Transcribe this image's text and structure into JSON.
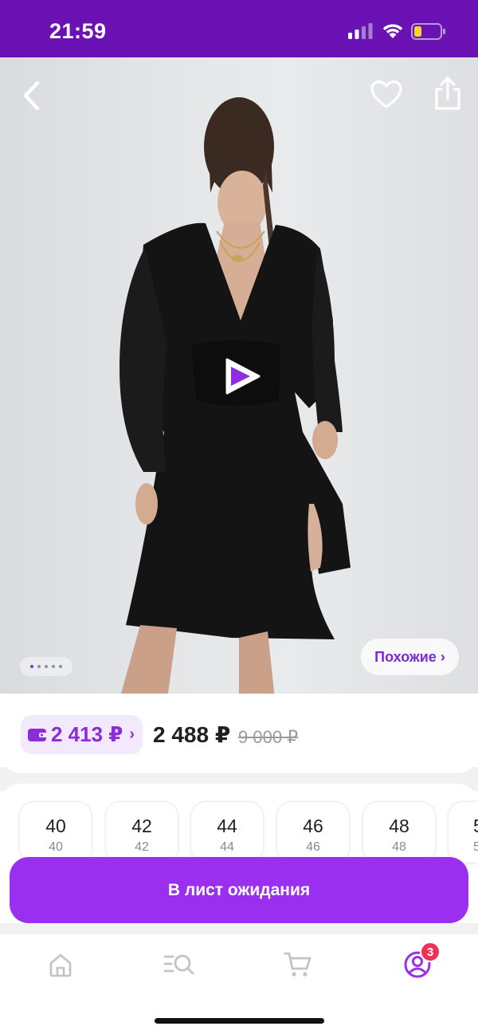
{
  "status_bar": {
    "time": "21:59",
    "icons": [
      "signal-icon",
      "wifi-icon",
      "battery-icon"
    ]
  },
  "product": {
    "image_alt_icon": "play-icon",
    "gallery_pages": 5,
    "gallery_active_index": 0,
    "similar_label": "Похожие ›"
  },
  "price": {
    "wallet_price": "2 413 ₽",
    "wallet_chevron": "›",
    "current_price": "2 488 ₽",
    "old_price": "9 000 ₽"
  },
  "sizes": [
    {
      "size": "40",
      "ru": "40"
    },
    {
      "size": "42",
      "ru": "42"
    },
    {
      "size": "44",
      "ru": "44"
    },
    {
      "size": "46",
      "ru": "46"
    },
    {
      "size": "48",
      "ru": "48"
    },
    {
      "size": "5",
      "ru": "5"
    }
  ],
  "cta": {
    "label": "В лист ожидания"
  },
  "tab_bar": {
    "items": [
      "home-icon",
      "catalog-search-icon",
      "cart-icon",
      "profile-icon"
    ],
    "profile_badge": "3"
  },
  "colors": {
    "brand": "#6b11b4",
    "accent": "#9a2ff0",
    "badge": "#ee3155",
    "wallet_text": "#8c2bd9"
  }
}
